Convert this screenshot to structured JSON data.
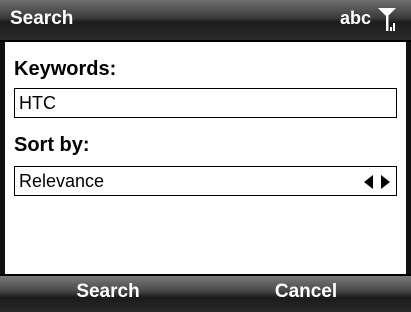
{
  "titlebar": {
    "title": "Search",
    "input_mode": "abc",
    "signal_icon": "signal-antenna-icon"
  },
  "form": {
    "keywords_label": "Keywords:",
    "keywords_value": "HTC",
    "sort_label": "Sort by:",
    "sort_value": "Relevance",
    "sort_arrows_icon": "left-right-arrows-icon"
  },
  "softkeys": {
    "left": "Search",
    "right": "Cancel"
  }
}
